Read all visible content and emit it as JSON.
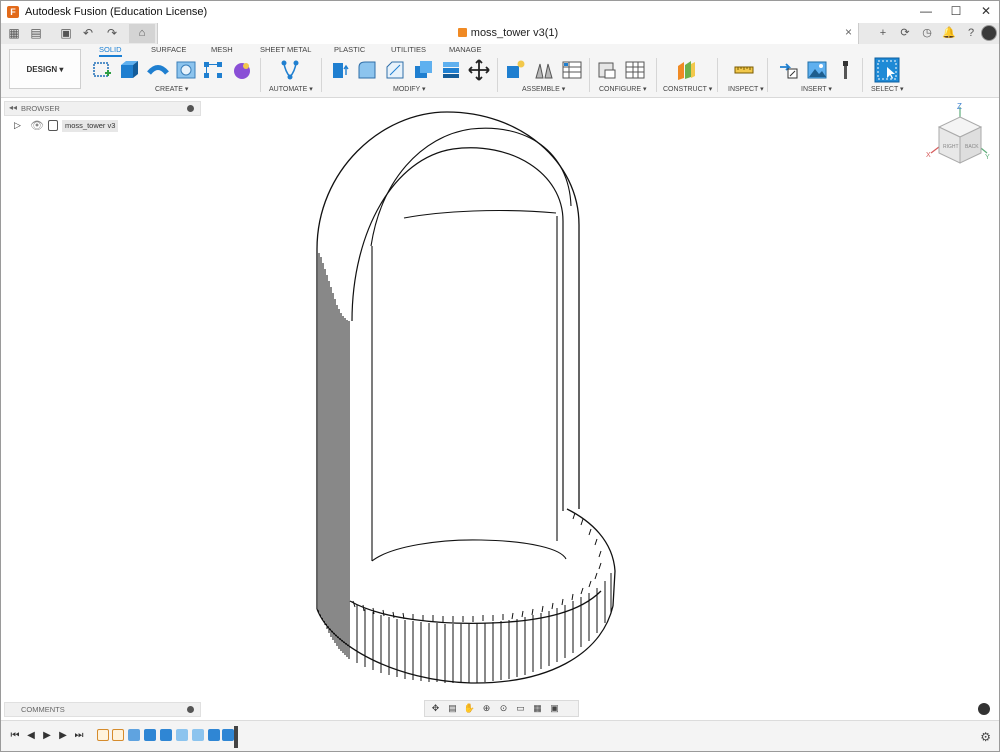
{
  "window": {
    "title": "Autodesk Fusion (Education License)",
    "controls": {
      "minimize": "—",
      "maximize": "☐",
      "close": "✕"
    }
  },
  "document": {
    "tab_title": "moss_tower v3(1)",
    "close_glyph": "×"
  },
  "ribbon": {
    "workspace_button": "DESIGN",
    "tabs": [
      "SOLID",
      "SURFACE",
      "MESH",
      "SHEET METAL",
      "PLASTIC",
      "UTILITIES",
      "MANAGE"
    ],
    "active_tab": "SOLID",
    "groups": [
      "CREATE",
      "AUTOMATE",
      "MODIFY",
      "ASSEMBLE",
      "CONFIGURE",
      "CONSTRUCT",
      "INSPECT",
      "INSERT",
      "SELECT"
    ]
  },
  "browser": {
    "header": "BROWSER",
    "collapse_glyph": "◂◂",
    "items": [
      {
        "label": "moss_tower v3"
      }
    ]
  },
  "comments": {
    "header": "COMMENTS"
  },
  "viewcube": {
    "faces": [
      "RIGHT",
      "BACK"
    ],
    "axes": [
      "Z",
      "X",
      "Y"
    ]
  },
  "colors": {
    "accent": "#1a7fd4",
    "select_blue": "#1e8ad6",
    "fusion_orange": "#e26a1a",
    "construct_orange": "#f08a24"
  }
}
